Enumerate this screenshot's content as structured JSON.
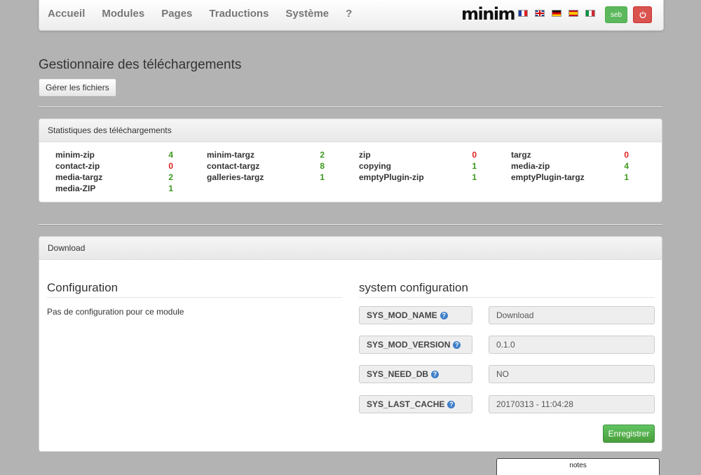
{
  "nav": {
    "links": [
      "Accueil",
      "Modules",
      "Pages",
      "Traductions",
      "Système",
      "?"
    ],
    "logo": "minim",
    "flags": [
      "fr",
      "en",
      "de",
      "es",
      "it"
    ],
    "user": "seb",
    "power_icon": "power-icon"
  },
  "header": {
    "title": "Gestionnaire des téléchargements",
    "manage_button": "Gérer les fichiers"
  },
  "stats": {
    "heading": "Statistiques des téléchargements",
    "items": [
      {
        "name": "minim-zip",
        "value": "4",
        "status": "ok"
      },
      {
        "name": "contact-zip",
        "value": "0",
        "status": "zero"
      },
      {
        "name": "media-targz",
        "value": "2",
        "status": "ok"
      },
      {
        "name": "media-ZIP",
        "value": "1",
        "status": "ok"
      },
      {
        "name": "minim-targz",
        "value": "2",
        "status": "ok"
      },
      {
        "name": "contact-targz",
        "value": "8",
        "status": "ok"
      },
      {
        "name": "galleries-targz",
        "value": "1",
        "status": "ok"
      },
      {
        "name": "zip",
        "value": "0",
        "status": "zero"
      },
      {
        "name": "copying",
        "value": "1",
        "status": "ok"
      },
      {
        "name": "emptyPlugin-zip",
        "value": "1",
        "status": "ok"
      },
      {
        "name": "targz",
        "value": "0",
        "status": "zero"
      },
      {
        "name": "media-zip",
        "value": "4",
        "status": "ok"
      },
      {
        "name": "emptyPlugin-targz",
        "value": "1",
        "status": "ok"
      }
    ]
  },
  "module": {
    "heading": "Download",
    "config_title": "Configuration",
    "config_note": "Pas de configuration pour ce module",
    "system_title": "system configuration",
    "system": [
      {
        "label": "SYS_MOD_NAME",
        "value": "Download"
      },
      {
        "label": "SYS_MOD_VERSION",
        "value": "0.1.0"
      },
      {
        "label": "SYS_NEED_DB",
        "value": "NO"
      },
      {
        "label": "SYS_LAST_CACHE",
        "value": "20170313 - 11:04:28"
      }
    ],
    "save_button": "Enregistrer"
  },
  "notes_tab": "notes",
  "colors": {
    "ok": "#3c9a1e",
    "zero": "#e0211d",
    "save": "#5cb85c",
    "danger": "#d9534f"
  }
}
